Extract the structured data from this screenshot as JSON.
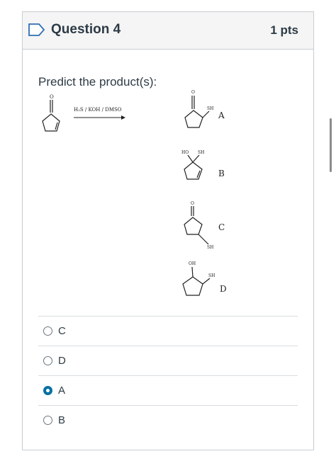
{
  "question": {
    "title": "Question 4",
    "points": "1 pts",
    "prompt": "Predict the product(s):"
  },
  "scheme": {
    "reagents": "H₂S / KOH / DMSO",
    "reactant_o": "O",
    "products": [
      {
        "letter": "A",
        "labels": [
          "O",
          "SH"
        ]
      },
      {
        "letter": "B",
        "labels": [
          "HO",
          "SH"
        ]
      },
      {
        "letter": "C",
        "labels": [
          "O",
          "SH"
        ]
      },
      {
        "letter": "D",
        "labels": [
          "OH",
          "SH"
        ]
      }
    ]
  },
  "answers": [
    {
      "label": "C",
      "selected": false
    },
    {
      "label": "D",
      "selected": false
    },
    {
      "label": "A",
      "selected": true
    },
    {
      "label": "B",
      "selected": false
    }
  ],
  "colors": {
    "accent": "#0770a3",
    "border": "#c7cdd1",
    "header_bg": "#f5f5f5"
  }
}
